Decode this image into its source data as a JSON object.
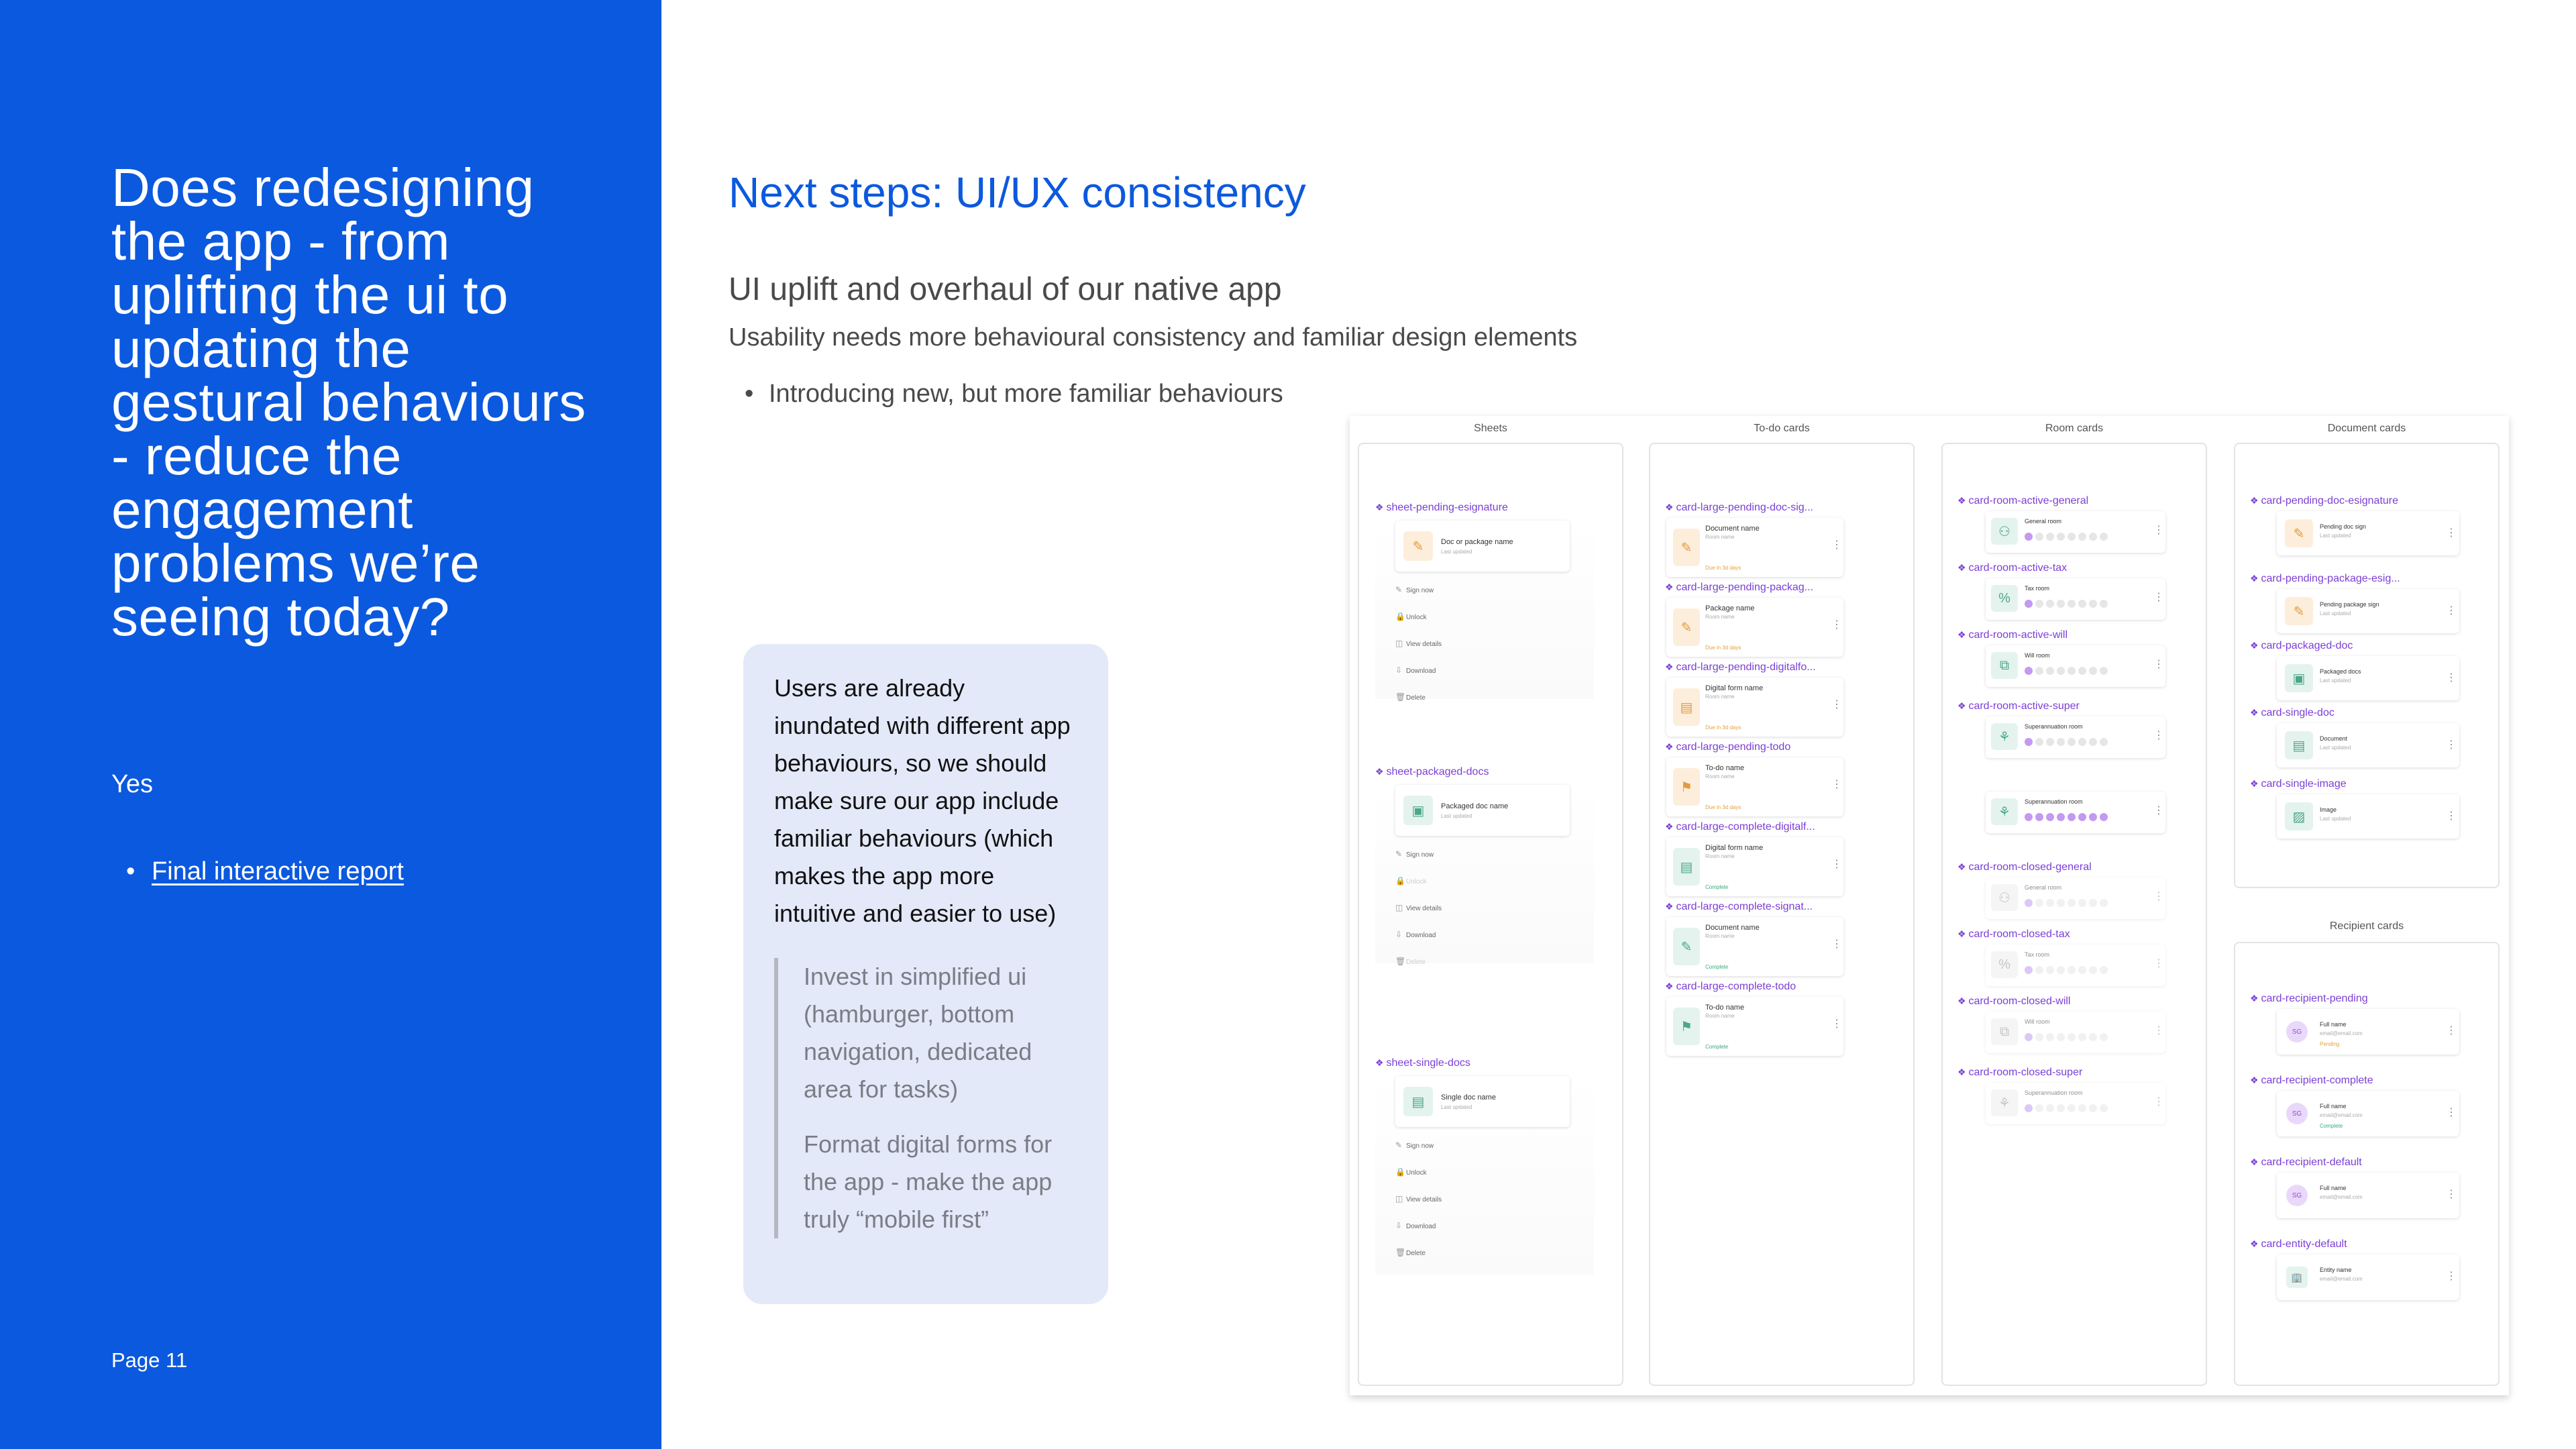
{
  "left": {
    "title": "Does redesigning the app - from uplifting the ui to updating the gestural behaviours - reduce the engagement problems we’re seeing today?",
    "answer": "Yes",
    "link": "Final interactive report",
    "page": "Page 11"
  },
  "main": {
    "heading": "Next steps: UI/UX consistency",
    "subheading": "UI uplift and overhaul of our native app",
    "subtext": "Usability needs more behavioural  consistency and familiar design elements",
    "bullet": "Introducing new, but more familiar behaviours"
  },
  "callout": {
    "text": "Users are already inundated with different app behaviours, so we should make sure our app include familiar behaviours (which makes the app more intuitive and easier to use)",
    "quotes": [
      "Invest in simplified ui (hamburger, bottom navigation, dedicated area for tasks)",
      "Format digital forms for the app - make the app truly “mobile first”"
    ]
  },
  "design_system": {
    "columns": [
      "Sheets",
      "To-do cards",
      "Room cards",
      "Document cards",
      "Recipient cards"
    ],
    "sheet_actions": [
      "Sign now",
      "Unlock",
      "View details",
      "Download",
      "Delete"
    ],
    "sheets": [
      {
        "label": "sheet-pending-esignature",
        "title": "Doc or package name",
        "sub": "Last updated"
      },
      {
        "label": "sheet-packaged-docs",
        "title": "Packaged doc name",
        "sub": "Last updated"
      },
      {
        "label": "sheet-single-docs",
        "title": "Single doc name",
        "sub": "Last updated"
      }
    ],
    "todo": [
      {
        "label": "card-large-pending-doc-sig...",
        "title": "Document name",
        "sub": "Room name",
        "note": "Due in 3d days"
      },
      {
        "label": "card-large-pending-packag...",
        "title": "Package name",
        "sub": "Room name",
        "note": "Due in 3d days"
      },
      {
        "label": "card-large-pending-digitalfo...",
        "title": "Digital form name",
        "sub": "Room name",
        "note": "Due in 3d days"
      },
      {
        "label": "card-large-pending-todo",
        "title": "To-do name",
        "sub": "Room name",
        "note": "Due in 3d days"
      },
      {
        "label": "card-large-complete-digitalf...",
        "title": "Digital form name",
        "sub": "Room name",
        "note": "Complete"
      },
      {
        "label": "card-large-complete-signat...",
        "title": "Document name",
        "sub": "Room name",
        "note": "Complete"
      },
      {
        "label": "card-large-complete-todo",
        "title": "To-do name",
        "sub": "Room name",
        "note": "Complete"
      }
    ],
    "rooms": [
      {
        "label": "card-room-active-general",
        "title": "General room"
      },
      {
        "label": "card-room-active-tax",
        "title": "Tax room"
      },
      {
        "label": "card-room-active-will",
        "title": "Will room"
      },
      {
        "label": "card-room-active-super",
        "title": "Superannuation room"
      },
      {
        "label": "",
        "title": "Superannuation room"
      },
      {
        "label": "card-room-closed-general",
        "title": "General room"
      },
      {
        "label": "card-room-closed-tax",
        "title": "Tax room"
      },
      {
        "label": "card-room-closed-will",
        "title": "Will room"
      },
      {
        "label": "card-room-closed-super",
        "title": "Superannuation room"
      }
    ],
    "docs": [
      {
        "label": "card-pending-doc-esignature",
        "title": "Pending doc sign",
        "sub": "Last updated"
      },
      {
        "label": "card-pending-package-esig...",
        "title": "Pending package sign",
        "sub": "Last updated"
      },
      {
        "label": "card-packaged-doc",
        "title": "Packaged docs",
        "sub": "Last updated"
      },
      {
        "label": "card-single-doc",
        "title": "Document",
        "sub": "Last updated"
      },
      {
        "label": "card-single-image",
        "title": "Image",
        "sub": "Last updated"
      }
    ],
    "recipients": [
      {
        "label": "card-recipient-pending",
        "title": "Full name",
        "sub": "email@email.com",
        "note": "Pending",
        "initials": "SG"
      },
      {
        "label": "card-recipient-complete",
        "title": "Full name",
        "sub": "email@email.com",
        "note": "Complete",
        "initials": "SG"
      },
      {
        "label": "card-recipient-default",
        "title": "Full name",
        "sub": "email@email.com",
        "note": "",
        "initials": "SG"
      },
      {
        "label": "card-entity-default",
        "title": "Entity name",
        "sub": "email@email.com",
        "note": "",
        "initials": ""
      }
    ]
  }
}
